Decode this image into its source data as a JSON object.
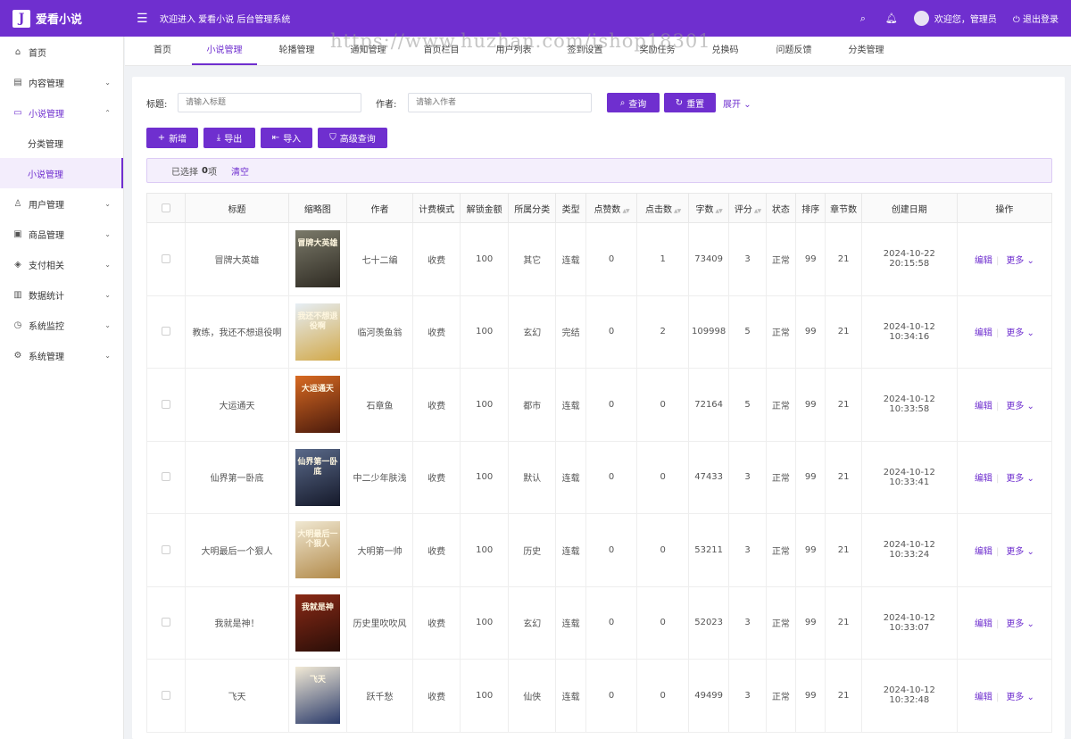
{
  "app": {
    "logo_letter": "J",
    "name": "爱看小说",
    "welcome": "欢迎进入 爱看小说 后台管理系统",
    "user_greeting": "欢迎您，管理员",
    "logout": "退出登录"
  },
  "watermark": "https://www.huzhan.com/ishop18301",
  "sidebar": {
    "items": [
      {
        "label": "首页",
        "icon": "home-icon",
        "glyph": "⌂"
      },
      {
        "label": "内容管理",
        "icon": "document-icon",
        "glyph": "▤",
        "chev": "⌄"
      },
      {
        "label": "小说管理",
        "icon": "book-icon",
        "glyph": "▭",
        "chev": "⌃"
      },
      {
        "label": "分类管理"
      },
      {
        "label": "小说管理"
      },
      {
        "label": "用户管理",
        "icon": "user-icon",
        "glyph": "♙",
        "chev": "⌄"
      },
      {
        "label": "商品管理",
        "icon": "shop-icon",
        "glyph": "▣",
        "chev": "⌄"
      },
      {
        "label": "支付相关",
        "icon": "shield-icon",
        "glyph": "◈",
        "chev": "⌄"
      },
      {
        "label": "数据统计",
        "icon": "chart-icon",
        "glyph": "▥",
        "chev": "⌄"
      },
      {
        "label": "系统监控",
        "icon": "monitor-icon",
        "glyph": "◷",
        "chev": "⌄"
      },
      {
        "label": "系统管理",
        "icon": "gear-icon",
        "glyph": "⚙",
        "chev": "⌄"
      }
    ]
  },
  "tabs": [
    "首页",
    "小说管理",
    "轮播管理",
    "通知管理",
    "首页栏目",
    "用户列表",
    "签到设置",
    "奖励任务",
    "兑换码",
    "问题反馈",
    "分类管理"
  ],
  "search": {
    "title_label": "标题:",
    "title_placeholder": "请输入标题",
    "author_label": "作者:",
    "author_placeholder": "请输入作者",
    "query": "查询",
    "reset": "重置",
    "expand": "展开"
  },
  "toolbar": {
    "add": "新增",
    "export": "导出",
    "import": "导入",
    "advanced": "高级查询"
  },
  "selection": {
    "prefix": "已选择",
    "count": "0",
    "suffix": "项",
    "clear": "清空"
  },
  "table": {
    "headers": [
      "标题",
      "缩略图",
      "作者",
      "计费模式",
      "解锁金额",
      "所属分类",
      "类型",
      "点赞数",
      "点击数",
      "字数",
      "评分",
      "状态",
      "排序",
      "章节数",
      "创建日期",
      "操作"
    ],
    "edit_label": "编辑",
    "more_label": "更多",
    "rows": [
      {
        "title": "冒牌大英雄",
        "thumb_text": "冒牌大英雄",
        "author": "七十二编",
        "billing": "收费",
        "price": "100",
        "category": "其它",
        "type": "连载",
        "likes": "0",
        "clicks": "1",
        "words": "73409",
        "score": "3",
        "status": "正常",
        "sort": "99",
        "chapters": "21",
        "created": "2024-10-22 20:15:58",
        "c1": "#7b7a6a",
        "c2": "#2e2a22"
      },
      {
        "title": "教练，我还不想退役啊",
        "thumb_text": "我还不想退役啊",
        "author": "临河羡鱼翁",
        "billing": "收费",
        "price": "100",
        "category": "玄幻",
        "type": "完结",
        "likes": "0",
        "clicks": "2",
        "words": "109998",
        "score": "5",
        "status": "正常",
        "sort": "99",
        "chapters": "21",
        "created": "2024-10-12 10:34:16",
        "c1": "#e6eef5",
        "c2": "#d2a94a"
      },
      {
        "title": "大运通天",
        "thumb_text": "大运通天",
        "author": "石章鱼",
        "billing": "收费",
        "price": "100",
        "category": "都市",
        "type": "连载",
        "likes": "0",
        "clicks": "0",
        "words": "72164",
        "score": "5",
        "status": "正常",
        "sort": "99",
        "chapters": "21",
        "created": "2024-10-12 10:33:58",
        "c1": "#d86a22",
        "c2": "#4a1a0c"
      },
      {
        "title": "仙界第一卧底",
        "thumb_text": "仙界第一卧底",
        "author": "中二少年肤浅",
        "billing": "收费",
        "price": "100",
        "category": "默认",
        "type": "连载",
        "likes": "0",
        "clicks": "0",
        "words": "47433",
        "score": "3",
        "status": "正常",
        "sort": "99",
        "chapters": "21",
        "created": "2024-10-12 10:33:41",
        "c1": "#5a6a8a",
        "c2": "#15192a"
      },
      {
        "title": "大明最后一个狠人",
        "thumb_text": "大明最后一个狠人",
        "author": "大明第一帅",
        "billing": "收费",
        "price": "100",
        "category": "历史",
        "type": "连载",
        "likes": "0",
        "clicks": "0",
        "words": "53211",
        "score": "3",
        "status": "正常",
        "sort": "99",
        "chapters": "21",
        "created": "2024-10-12 10:33:24",
        "c1": "#f0e8d2",
        "c2": "#b28a4a"
      },
      {
        "title": "我就是神！",
        "thumb_text": "我就是神",
        "author": "历史里吹吹风",
        "billing": "收费",
        "price": "100",
        "category": "玄幻",
        "type": "连载",
        "likes": "0",
        "clicks": "0",
        "words": "52023",
        "score": "3",
        "status": "正常",
        "sort": "99",
        "chapters": "21",
        "created": "2024-10-12 10:33:07",
        "c1": "#8a2a16",
        "c2": "#2a0e08"
      },
      {
        "title": "飞天",
        "thumb_text": "飞天",
        "author": "跃千愁",
        "billing": "收费",
        "price": "100",
        "category": "仙侠",
        "type": "连载",
        "likes": "0",
        "clicks": "0",
        "words": "49499",
        "score": "3",
        "status": "正常",
        "sort": "99",
        "chapters": "21",
        "created": "2024-10-12 10:32:48",
        "c1": "#f2ead6",
        "c2": "#2a3a6a"
      }
    ]
  },
  "colors": {
    "accent": "#6f2fcf",
    "accent_light": "#f4effc"
  }
}
